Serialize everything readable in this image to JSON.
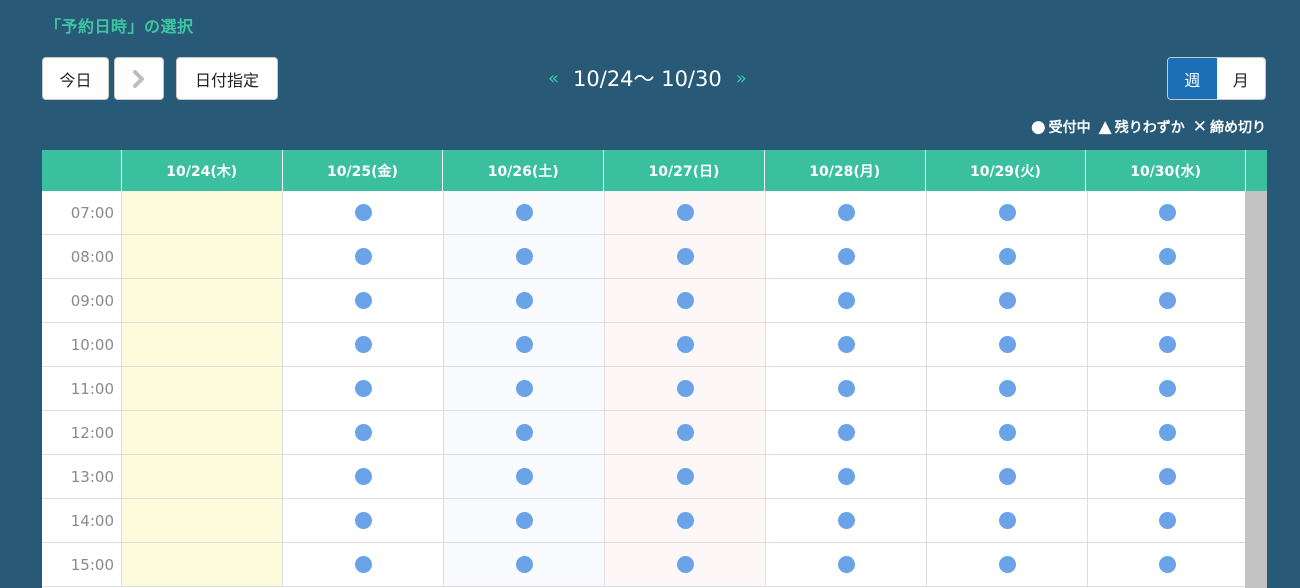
{
  "title": "「予約日時」の選択",
  "toolbar": {
    "today_label": "今日",
    "next_label": "›",
    "date_pick_label": "日付指定"
  },
  "range": {
    "prev": "«",
    "label": "10/24～ 10/30",
    "next": "»"
  },
  "view": {
    "week": "週",
    "month": "月",
    "active": "week"
  },
  "legend": [
    {
      "symbol": "●",
      "label": "受付中"
    },
    {
      "symbol": "▲",
      "label": "残りわずか"
    },
    {
      "symbol": "✕",
      "label": "締め切り"
    }
  ],
  "calendar": {
    "days": [
      "10/24(木)",
      "10/25(金)",
      "10/26(土)",
      "10/27(日)",
      "10/28(月)",
      "10/29(火)",
      "10/30(水)"
    ],
    "times": [
      "07:00",
      "08:00",
      "09:00",
      "10:00",
      "11:00",
      "12:00",
      "13:00",
      "14:00",
      "15:00"
    ],
    "slot_status": "available",
    "closed_day_index": 0
  },
  "colors": {
    "background": "#285a78",
    "header": "#3ac09e",
    "available_dot": "#6aa3e8",
    "closed_day": "#fefadc",
    "active_toggle": "#1a6fb6"
  }
}
